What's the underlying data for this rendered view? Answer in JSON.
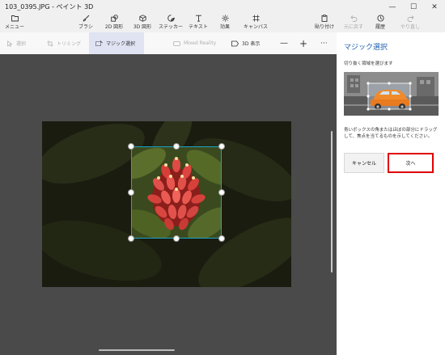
{
  "window": {
    "title": "103_0395.JPG - ペイント 3D",
    "controls": [
      "—",
      "☐",
      "✕"
    ]
  },
  "menu": {
    "label": "メニュー"
  },
  "toolbar": {
    "brush": "ブラシ",
    "shapes2d": "2D 図形",
    "shapes3d": "3D 図形",
    "stickers": "ステッカー",
    "text": "テキスト",
    "effects": "効果",
    "canvas": "キャンバス",
    "paste": "貼り付け",
    "undo": "元に戻す",
    "history": "履歴",
    "redo": "やり直し"
  },
  "subtoolbar": {
    "select": "選択",
    "crop": "トリミング",
    "magic_select": "マジック選択",
    "mixed_reality": "Mixed Reality",
    "view3d": "3D 表示",
    "zoom_out": "—",
    "zoom_in": "+",
    "more": "···"
  },
  "panel": {
    "title": "マジック選択",
    "description": "切り抜く領域を選びます",
    "help": "青いボックスの角またはほぼの部分にドラッグして、焦点を当てるものを示してください。",
    "cancel": "キャンセル",
    "next": "次へ"
  },
  "colors": {
    "accent": "#2060b0",
    "selection_border": "#19a6c8",
    "highlight_border": "#e00000",
    "canvas_bg": "#4a4a4a"
  }
}
